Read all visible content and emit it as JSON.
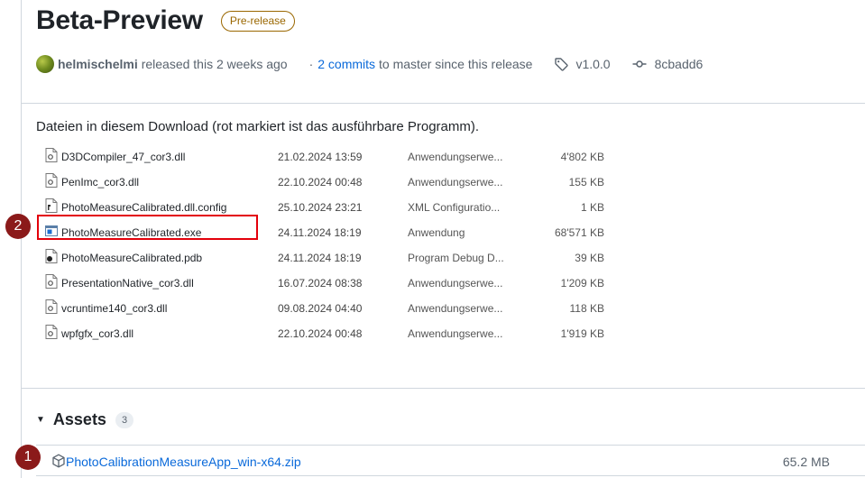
{
  "release": {
    "title": "Beta-Preview",
    "badge": "Pre-release",
    "author": "helmischelmi",
    "released_text": "released this 2 weeks ago",
    "separator": "·",
    "commits_link": "2 commits",
    "commits_suffix": "to master since this release",
    "tag": "v1.0.0",
    "commit_hash": "8cbadd6"
  },
  "downloads": {
    "heading": "Dateien in diesem Download (rot markiert ist das ausführbare Programm).",
    "files": [
      {
        "name": "D3DCompiler_47_cor3.dll",
        "date": "21.02.2024 13:59",
        "type": "Anwendungserwe...",
        "size": "4'802 KB",
        "icon": "dll-file-icon"
      },
      {
        "name": "PenImc_cor3.dll",
        "date": "22.10.2024 00:48",
        "type": "Anwendungserwe...",
        "size": "155 KB",
        "icon": "dll-file-icon"
      },
      {
        "name": "PhotoMeasureCalibrated.dll.config",
        "date": "25.10.2024 23:21",
        "type": "XML Configuratio...",
        "size": "1 KB",
        "icon": "config-file-icon"
      },
      {
        "name": "PhotoMeasureCalibrated.exe",
        "date": "24.11.2024 18:19",
        "type": "Anwendung",
        "size": "68'571 KB",
        "icon": "exe-file-icon"
      },
      {
        "name": "PhotoMeasureCalibrated.pdb",
        "date": "24.11.2024 18:19",
        "type": "Program Debug D...",
        "size": "39 KB",
        "icon": "pdb-file-icon"
      },
      {
        "name": "PresentationNative_cor3.dll",
        "date": "16.07.2024 08:38",
        "type": "Anwendungserwe...",
        "size": "1'209 KB",
        "icon": "dll-file-icon"
      },
      {
        "name": "vcruntime140_cor3.dll",
        "date": "09.08.2024 04:40",
        "type": "Anwendungserwe...",
        "size": "118 KB",
        "icon": "dll-file-icon"
      },
      {
        "name": "wpfgfx_cor3.dll",
        "date": "22.10.2024 00:48",
        "type": "Anwendungserwe...",
        "size": "1'919 KB",
        "icon": "dll-file-icon"
      }
    ],
    "highlighted_file": "PhotoMeasureCalibrated.exe"
  },
  "markers": {
    "asset_step": "1",
    "exe_step": "2"
  },
  "assets": {
    "title": "Assets",
    "count": "3",
    "items": [
      {
        "name": "PhotoCalibrationMeasureApp_win-x64.zip",
        "size": "65.2 MB"
      }
    ]
  },
  "colors": {
    "link": "#0969da",
    "prerelease": "#9a6700",
    "highlight": "#e3000b",
    "marker": "#8b1a1a",
    "muted": "#59636e"
  }
}
